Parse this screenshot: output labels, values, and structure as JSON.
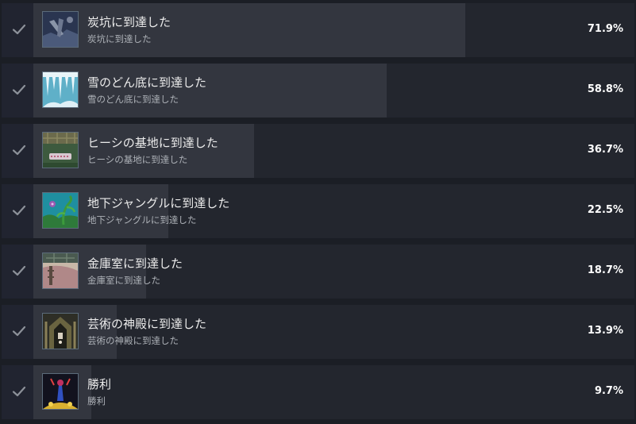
{
  "achievements": [
    {
      "title": "炭坑に到達した",
      "description": "炭坑に到達した",
      "percent_label": "71.9%",
      "percent": 71.9,
      "icon": "mine-shaft-icon",
      "unlocked": true
    },
    {
      "title": "雪のどん底に到達した",
      "description": "雪のどん底に到達した",
      "percent_label": "58.8%",
      "percent": 58.8,
      "icon": "snow-icicles-icon",
      "unlocked": true
    },
    {
      "title": "ヒーシの基地に到達した",
      "description": "ヒーシの基地に到達した",
      "percent_label": "36.7%",
      "percent": 36.7,
      "icon": "hiisi-base-icon",
      "unlocked": true
    },
    {
      "title": "地下ジャングルに到達した",
      "description": "地下ジャングルに到達した",
      "percent_label": "22.5%",
      "percent": 22.5,
      "icon": "jungle-icon",
      "unlocked": true
    },
    {
      "title": "金庫室に到達した",
      "description": "金庫室に到達した",
      "percent_label": "18.7%",
      "percent": 18.7,
      "icon": "vault-icon",
      "unlocked": true
    },
    {
      "title": "芸術の神殿に到達した",
      "description": "芸術の神殿に到達した",
      "percent_label": "13.9%",
      "percent": 13.9,
      "icon": "temple-icon",
      "unlocked": true
    },
    {
      "title": "勝利",
      "description": "勝利",
      "percent_label": "9.7%",
      "percent": 9.7,
      "icon": "victory-icon",
      "unlocked": true
    }
  ],
  "colors": {
    "background": "#1b1e25",
    "row": "#23262e",
    "progress_fill": "#33363f",
    "title_text": "#ebebeb",
    "desc_text": "#aeb2b8",
    "check": "#8c9199"
  }
}
